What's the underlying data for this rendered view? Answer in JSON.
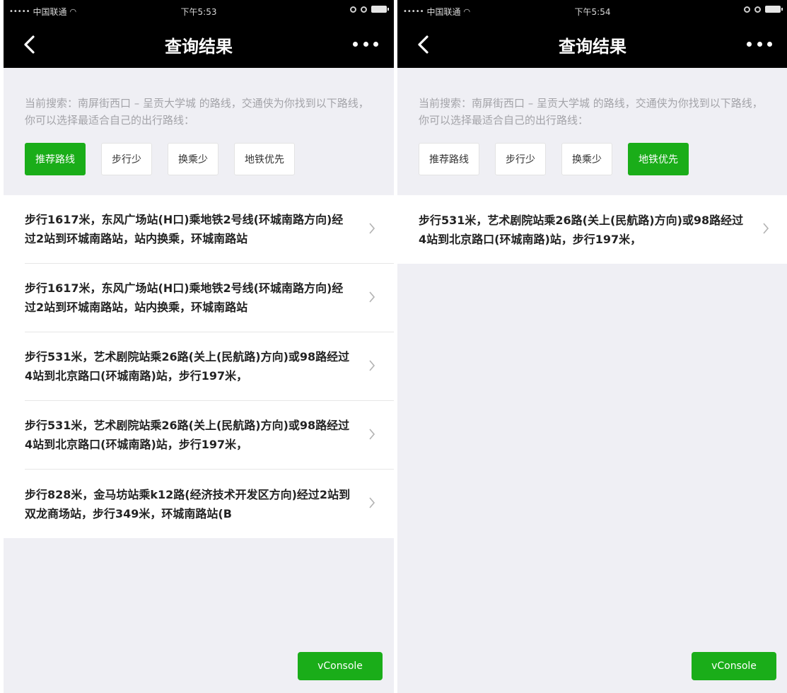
{
  "colors": {
    "accent": "#1aad19",
    "navbar": "#000000",
    "background": "#efeff4"
  },
  "left": {
    "status": {
      "dots": "•••••",
      "carrier": "中国联通",
      "time": "下午5:53"
    },
    "nav": {
      "title": "查询结果"
    },
    "intro": "当前搜索：南屏街西口 – 呈贡大学城 的路线，交通侠为你找到以下路线，你可以选择最适合自己的出行路线：",
    "filters": [
      {
        "label": "推荐路线",
        "active": true
      },
      {
        "label": "步行少",
        "active": false
      },
      {
        "label": "换乘少",
        "active": false
      },
      {
        "label": "地铁优先",
        "active": false
      }
    ],
    "routes": [
      "步行1617米，东风广场站(H口)乘地铁2号线(环城南路方向)经过2站到环城南路站，站内换乘，环城南路站",
      "步行1617米，东风广场站(H口)乘地铁2号线(环城南路方向)经过2站到环城南路站，站内换乘，环城南路站",
      "步行531米，艺术剧院站乘26路(关上(民航路)方向)或98路经过4站到北京路口(环城南路)站，步行197米，",
      "步行531米，艺术剧院站乘26路(关上(民航路)方向)或98路经过4站到北京路口(环城南路)站，步行197米，",
      "步行828米，金马坊站乘k12路(经济技术开发区方向)经过2站到双龙商场站，步行349米，环城南路站(B"
    ],
    "vconsole": "vConsole"
  },
  "right": {
    "status": {
      "dots": "•••••",
      "carrier": "中国联通",
      "time": "下午5:54"
    },
    "nav": {
      "title": "查询结果"
    },
    "intro": "当前搜索：南屏街西口 – 呈贡大学城 的路线，交通侠为你找到以下路线，你可以选择最适合自己的出行路线：",
    "filters": [
      {
        "label": "推荐路线",
        "active": false
      },
      {
        "label": "步行少",
        "active": false
      },
      {
        "label": "换乘少",
        "active": false
      },
      {
        "label": "地铁优先",
        "active": true
      }
    ],
    "routes": [
      "步行531米，艺术剧院站乘26路(关上(民航路)方向)或98路经过4站到北京路口(环城南路)站，步行197米，"
    ],
    "vconsole": "vConsole"
  }
}
